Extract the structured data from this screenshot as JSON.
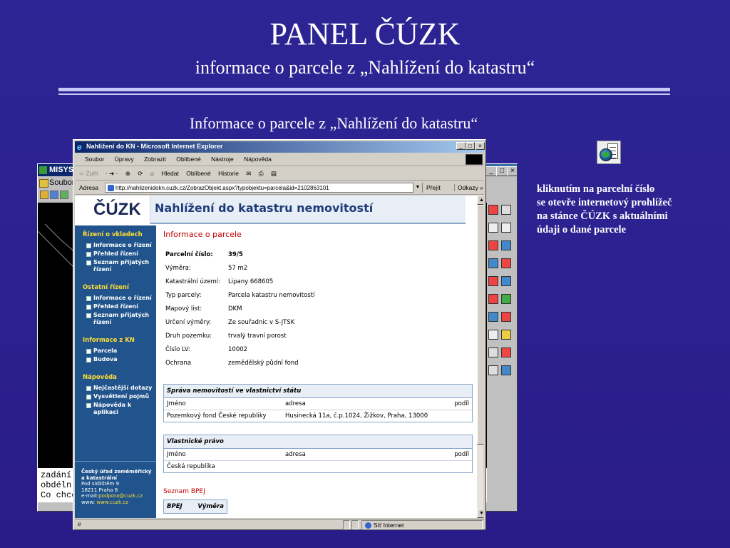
{
  "slide": {
    "title": "PANEL ČÚZK",
    "subtitle": "informace o parcele z „Nahlížení do katastru“",
    "caption": "Informace o parcele z „Nahlížení do katastru“",
    "sidenote_lines": [
      "kliknutím na parcelní číslo",
      "se otevře internetový prohlížeč",
      "na stánce ČÚZK s aktuálními",
      "údaji o dané parcele"
    ]
  },
  "misys": {
    "title": "MISYS",
    "menu_first": "Soubor",
    "cmd_lines": [
      "zadání  v",
      "  obdéln",
      " Co chceš"
    ]
  },
  "ie": {
    "title": "Nahlížení do KN - Microsoft Internet Explorer",
    "menu": [
      "Soubor",
      "Úpravy",
      "Zobrazit",
      "Oblíbené",
      "Nástroje",
      "Nápověda"
    ],
    "toolbar": {
      "back": "⇦ Zpět",
      "fwd": "· ➔ ·",
      "search": "Hledat",
      "favorites": "Oblíbené",
      "history": "Historie"
    },
    "address_label": "Adresa",
    "address_url": "http://nahlizenidokn.cuzk.cz/ZobrazObjekt.aspx?typobjektu=parcela&id=2102863101",
    "go_label": "Přejít",
    "links_label": "Odkazy »",
    "status_zone": "Síť Internet"
  },
  "page": {
    "logo": "ČÚZK",
    "banner_title": "Nahlížení do katastru nemovitostí",
    "nav": [
      {
        "section": "Řízení o vkladech",
        "items": [
          "Informace o řízení",
          "Přehled řízení",
          "Seznam přijatých řízení"
        ]
      },
      {
        "section": "Ostatní řízení",
        "items": [
          "Informace o řízení",
          "Přehled řízení",
          "Seznam přijatých řízení"
        ]
      },
      {
        "section": "Informace z KN",
        "items": [
          "Parcela",
          "Budova"
        ]
      },
      {
        "section": "Nápověda",
        "items": [
          "Nejčastější dotazy",
          "Vysvětlení pojmů",
          "Nápověda k aplikaci"
        ]
      }
    ],
    "footer": {
      "org1": "Český úřad zeměměřický",
      "org2": "a katastrální",
      "addr1": "Pod sídlištěm 9",
      "addr2": "18211 Praha 8",
      "email_label": "e-mail:",
      "email": "podpora@cuzk.cz",
      "www_label": "www:",
      "www": "www.cuzk.cz"
    },
    "section_title": "Informace o parcele",
    "fields": [
      {
        "k": "Parcelní číslo:",
        "v": "39/5"
      },
      {
        "k": "Výměra:",
        "v": "57 m2"
      },
      {
        "k": "Katastrální území:",
        "v": "Lipany 668605"
      },
      {
        "k": "Typ parcely:",
        "v": "Parcela katastru nemovitostí"
      },
      {
        "k": "Mapový list:",
        "v": "DKM"
      },
      {
        "k": "Určení výměry:",
        "v": "Ze souřadnic v S-JTSK"
      },
      {
        "k": "Druh pozemku:",
        "v": "trvalý travní porost"
      },
      {
        "k": "Číslo LV:",
        "v": "10002"
      },
      {
        "k": "Ochrana",
        "v": "zemědělský půdní fond"
      }
    ],
    "sprava": {
      "title": "Správa nemovitostí ve vlastnictví státu",
      "cols": [
        "Jméno",
        "adresa",
        "podíl"
      ],
      "rows": [
        [
          "Pozemkový fond České republiky",
          "Husinecká 11a, č.p.1024, Žižkov, Praha, 13000",
          ""
        ]
      ]
    },
    "vlastnicke": {
      "title": "Vlastnické právo",
      "cols": [
        "Jméno",
        "adresa",
        "podíl"
      ],
      "rows": [
        [
          "Česká republika",
          "",
          ""
        ]
      ]
    },
    "bpej_title": "Seznam BPEJ",
    "bpej_cols": [
      "BPEJ",
      "Výměra"
    ]
  }
}
